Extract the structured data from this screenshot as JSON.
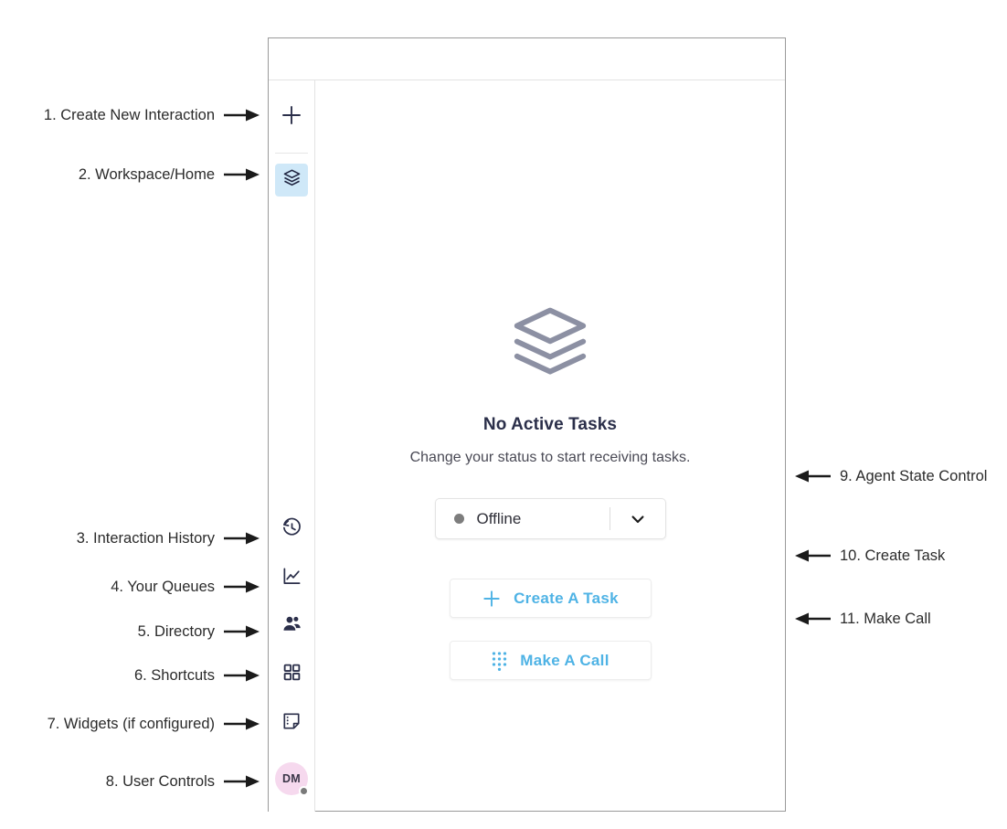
{
  "annotations": {
    "left": [
      {
        "label": "1. Create New Interaction",
        "arrow": "arrow-right-icon"
      },
      {
        "label": "2. Workspace/Home",
        "arrow": "arrow-right-icon"
      },
      {
        "label": "3. Interaction History",
        "arrow": "arrow-right-icon"
      },
      {
        "label": "4. Your Queues",
        "arrow": "arrow-right-icon"
      },
      {
        "label": "5. Directory",
        "arrow": "arrow-right-icon"
      },
      {
        "label": "6. Shortcuts",
        "arrow": "arrow-right-icon"
      },
      {
        "label": "7. Widgets (if configured)",
        "arrow": "arrow-right-icon"
      },
      {
        "label": "8. User Controls",
        "arrow": "arrow-right-icon"
      }
    ],
    "right": [
      {
        "label": "9. Agent State Control",
        "arrow": "arrow-left-icon"
      },
      {
        "label": "10. Create Task",
        "arrow": "arrow-left-icon"
      },
      {
        "label": "11. Make Call",
        "arrow": "arrow-left-icon"
      }
    ]
  },
  "sidebar": {
    "items": [
      {
        "name": "create-new-interaction",
        "icon": "plus-icon",
        "active": false
      },
      {
        "name": "workspace-home",
        "icon": "layers-icon",
        "active": true
      },
      {
        "name": "interaction-history",
        "icon": "history-clock-icon",
        "active": false
      },
      {
        "name": "your-queues",
        "icon": "line-chart-icon",
        "active": false
      },
      {
        "name": "directory",
        "icon": "people-icon",
        "active": false
      },
      {
        "name": "shortcuts",
        "icon": "grid-icon",
        "active": false
      },
      {
        "name": "widgets",
        "icon": "note-widget-icon",
        "active": false
      }
    ],
    "user": {
      "initials": "DM",
      "presence": "offline"
    }
  },
  "main": {
    "illustration_icon": "layers-stack-icon",
    "title": "No Active Tasks",
    "subtitle": "Change your status to start receiving tasks.",
    "status": {
      "value": "Offline",
      "dot_color": "#7d7d7d",
      "caret_icon": "chevron-down-icon"
    },
    "buttons": [
      {
        "label": "Create A Task",
        "icon": "plus-icon"
      },
      {
        "label": "Make A Call",
        "icon": "dialpad-icon"
      }
    ]
  },
  "colors": {
    "accent": "#4fb3e5",
    "active_nav_bg": "#cfe8f8",
    "nav_icon": "#2b2f4a",
    "illustration": "#8c90a3",
    "avatar_bg": "#f6d9ee"
  }
}
